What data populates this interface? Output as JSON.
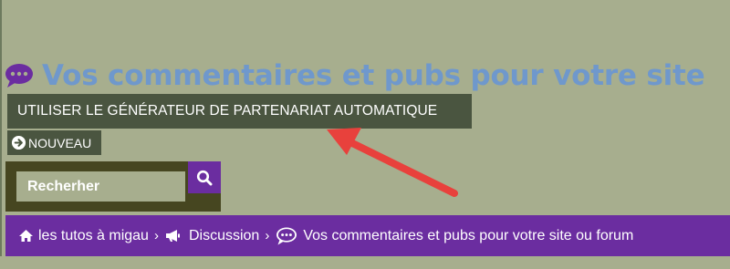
{
  "title": {
    "icon": "speech-bubble-icon",
    "text": "Vos commentaires et pubs pour votre site"
  },
  "generator_button": {
    "label": "UTILISER LE GÉNÉRATEUR DE PARTENARIAT AUTOMATIQUE"
  },
  "new_button": {
    "icon": "circle-arrow-right-icon",
    "label": "NOUVEAU"
  },
  "search": {
    "placeholder": "Recherher",
    "icon": "search-icon"
  },
  "breadcrumb": {
    "items": [
      {
        "icon": "home-icon",
        "label": "les tutos à migau"
      },
      {
        "icon": "bullhorn-icon",
        "label": "Discussion"
      },
      {
        "icon": "speech-bubble-icon",
        "label": "Vos commentaires et pubs pour votre site ou forum"
      }
    ],
    "separator": "›"
  },
  "colors": {
    "background": "#a7ae8e",
    "title": "#6f98cc",
    "dark_green": "#4a5540",
    "olive": "#464620",
    "purple": "#6b2da0",
    "annotation_arrow": "#e8413c"
  }
}
